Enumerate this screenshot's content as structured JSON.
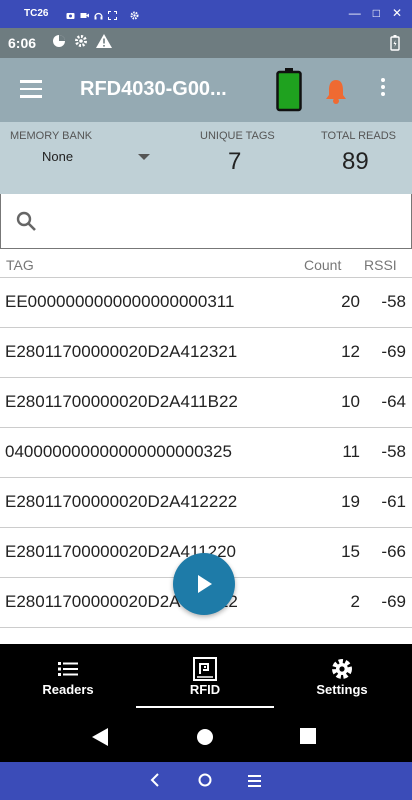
{
  "emulator": {
    "title": "TC26"
  },
  "status_bar": {
    "time": "6:06"
  },
  "app_bar": {
    "title": "RFD4030-G00...",
    "battery_color": "#1fa21f",
    "alarm_color": "#ef6a32"
  },
  "stats": {
    "memory_bank_label": "MEMORY BANK",
    "memory_bank_value": "None",
    "unique_tags_label": "UNIQUE TAGS",
    "unique_tags_value": "7",
    "total_reads_label": "TOTAL READS",
    "total_reads_value": "89"
  },
  "search": {
    "placeholder": ""
  },
  "table": {
    "headers": {
      "tag": "TAG",
      "count": "Count",
      "rssi": "RSSI"
    },
    "rows": [
      {
        "tag": "EE0000000000000000000311",
        "count": "20",
        "rssi": "-58"
      },
      {
        "tag": "E28011700000020D2A412321",
        "count": "12",
        "rssi": "-69"
      },
      {
        "tag": "E28011700000020D2A411B22",
        "count": "10",
        "rssi": "-64"
      },
      {
        "tag": "040000000000000000000325",
        "count": "11",
        "rssi": "-58"
      },
      {
        "tag": "E28011700000020D2A412222",
        "count": "19",
        "rssi": "-61"
      },
      {
        "tag": "E28011700000020D2A411220",
        "count": "15",
        "rssi": "-66"
      },
      {
        "tag": "E28011700000020D2A411A22",
        "count": "2",
        "rssi": "-69"
      }
    ]
  },
  "bottom_nav": {
    "readers": "Readers",
    "rfid": "RFID",
    "settings": "Settings",
    "active": "RFID"
  },
  "colors": {
    "accent": "#1e7ba8",
    "appbar": "#95aab3",
    "stats_bg": "#bfd0d6",
    "emulator_frame": "#3b4cb8"
  }
}
